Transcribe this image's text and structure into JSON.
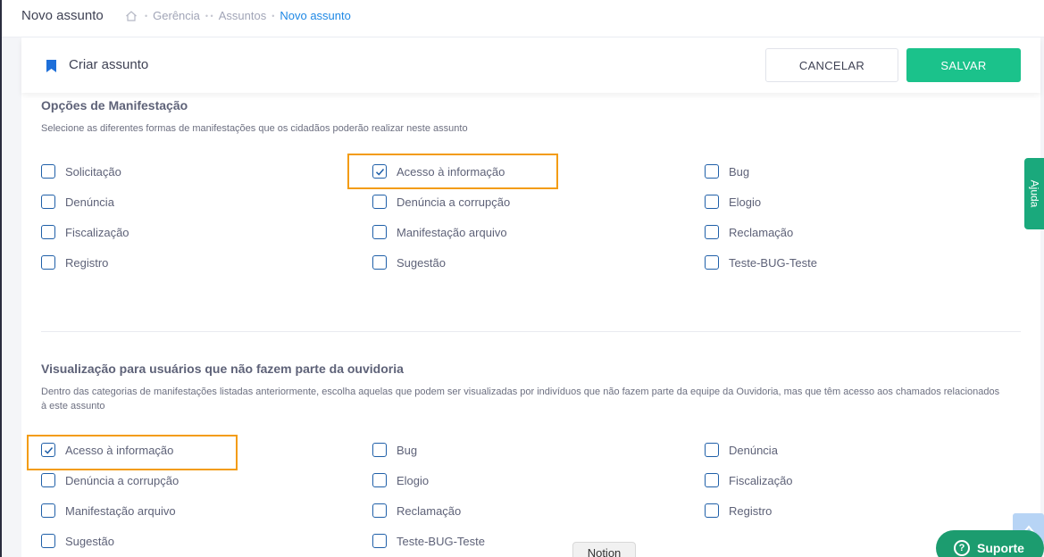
{
  "header": {
    "page_title": "Novo assunto",
    "breadcrumb": [
      "Gerência",
      "Assuntos",
      "Novo assunto"
    ]
  },
  "card": {
    "title": "Criar assunto",
    "cancel_label": "CANCELAR",
    "save_label": "SALVAR"
  },
  "section1": {
    "title": "Opções de Manifestação",
    "description": "Selecione as diferentes formas de manifestações que os cidadãos poderão realizar neste assunto",
    "options": [
      {
        "label": "Solicitação",
        "checked": false
      },
      {
        "label": "Acesso à informação",
        "checked": true
      },
      {
        "label": "Bug",
        "checked": false
      },
      {
        "label": "Denúncia",
        "checked": false
      },
      {
        "label": "Denúncia a corrupção",
        "checked": false
      },
      {
        "label": "Elogio",
        "checked": false
      },
      {
        "label": "Fiscalização",
        "checked": false
      },
      {
        "label": "Manifestação arquivo",
        "checked": false
      },
      {
        "label": "Reclamação",
        "checked": false
      },
      {
        "label": "Registro",
        "checked": false
      },
      {
        "label": "Sugestão",
        "checked": false
      },
      {
        "label": "Teste-BUG-Teste",
        "checked": false
      }
    ]
  },
  "section2": {
    "title": "Visualização para usuários que não fazem parte da ouvidoria",
    "description": "Dentro das categorias de manifestações listadas anteriormente, escolha aquelas que podem ser visualizadas por indivíduos que não fazem parte da equipe da Ouvidoria, mas que têm acesso aos chamados relacionados à este assunto",
    "options": [
      {
        "label": "Acesso à informação",
        "checked": true
      },
      {
        "label": "Bug",
        "checked": false
      },
      {
        "label": "Denúncia",
        "checked": false
      },
      {
        "label": "Denúncia a corrupção",
        "checked": false
      },
      {
        "label": "Elogio",
        "checked": false
      },
      {
        "label": "Fiscalização",
        "checked": false
      },
      {
        "label": "Manifestação arquivo",
        "checked": false
      },
      {
        "label": "Reclamação",
        "checked": false
      },
      {
        "label": "Registro",
        "checked": false
      },
      {
        "label": "Sugestão",
        "checked": false
      },
      {
        "label": "Teste-BUG-Teste",
        "checked": false
      }
    ]
  },
  "widgets": {
    "help_label": "Ajuda",
    "support_label": "Suporte",
    "notion_label": "Notion"
  },
  "colors": {
    "accent": "#1e88e5",
    "save": "#1bc28b",
    "highlight": "#f39c12",
    "checkbox": "#1f5fa8"
  }
}
